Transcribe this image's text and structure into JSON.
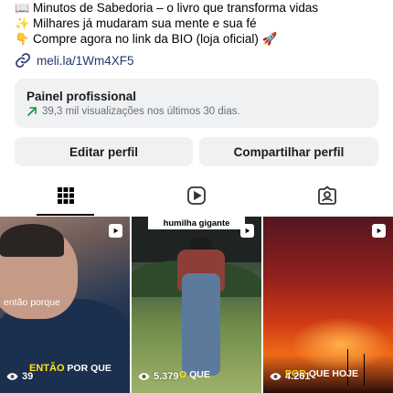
{
  "bio": {
    "line1_emoji": "📖",
    "line1": "Minutos de Sabedoria – o livro que transforma vidas",
    "line2_emoji": "✨",
    "line2": "Milhares já mudaram sua mente e sua fé",
    "line3_emoji": "👇",
    "line3": "Compre agora no link da BIO (loja oficial) 🚀",
    "link": "meli.la/1Wm4XF5",
    "link_color": "#23386b"
  },
  "professional_panel": {
    "title": "Painel profissional",
    "stats": "39,3 mil visualizações nos últimos 30 dias.",
    "trend_color": "#1a8f3c"
  },
  "buttons": {
    "edit_profile": "Editar perfil",
    "share_profile": "Compartilhar perfil"
  },
  "tabs": [
    {
      "name": "grid",
      "icon": "grid-icon",
      "active": true
    },
    {
      "name": "reels",
      "icon": "reels-icon",
      "active": false
    },
    {
      "name": "tagged",
      "icon": "tagged-icon",
      "active": false
    }
  ],
  "posts": [
    {
      "caption_small": "então porque",
      "caption_big_yellow": "ENTÃO",
      "caption_big_white": "POR QUE",
      "views": "39",
      "type": "reel"
    },
    {
      "top_label": "humilha gigante",
      "caption_big_yellow": "O",
      "caption_big_white": "QUE",
      "views": "5.379",
      "type": "reel"
    },
    {
      "caption_big_yellow": "POR",
      "caption_big_white": "QUE HOJE",
      "views": "4.261",
      "type": "reel"
    }
  ]
}
